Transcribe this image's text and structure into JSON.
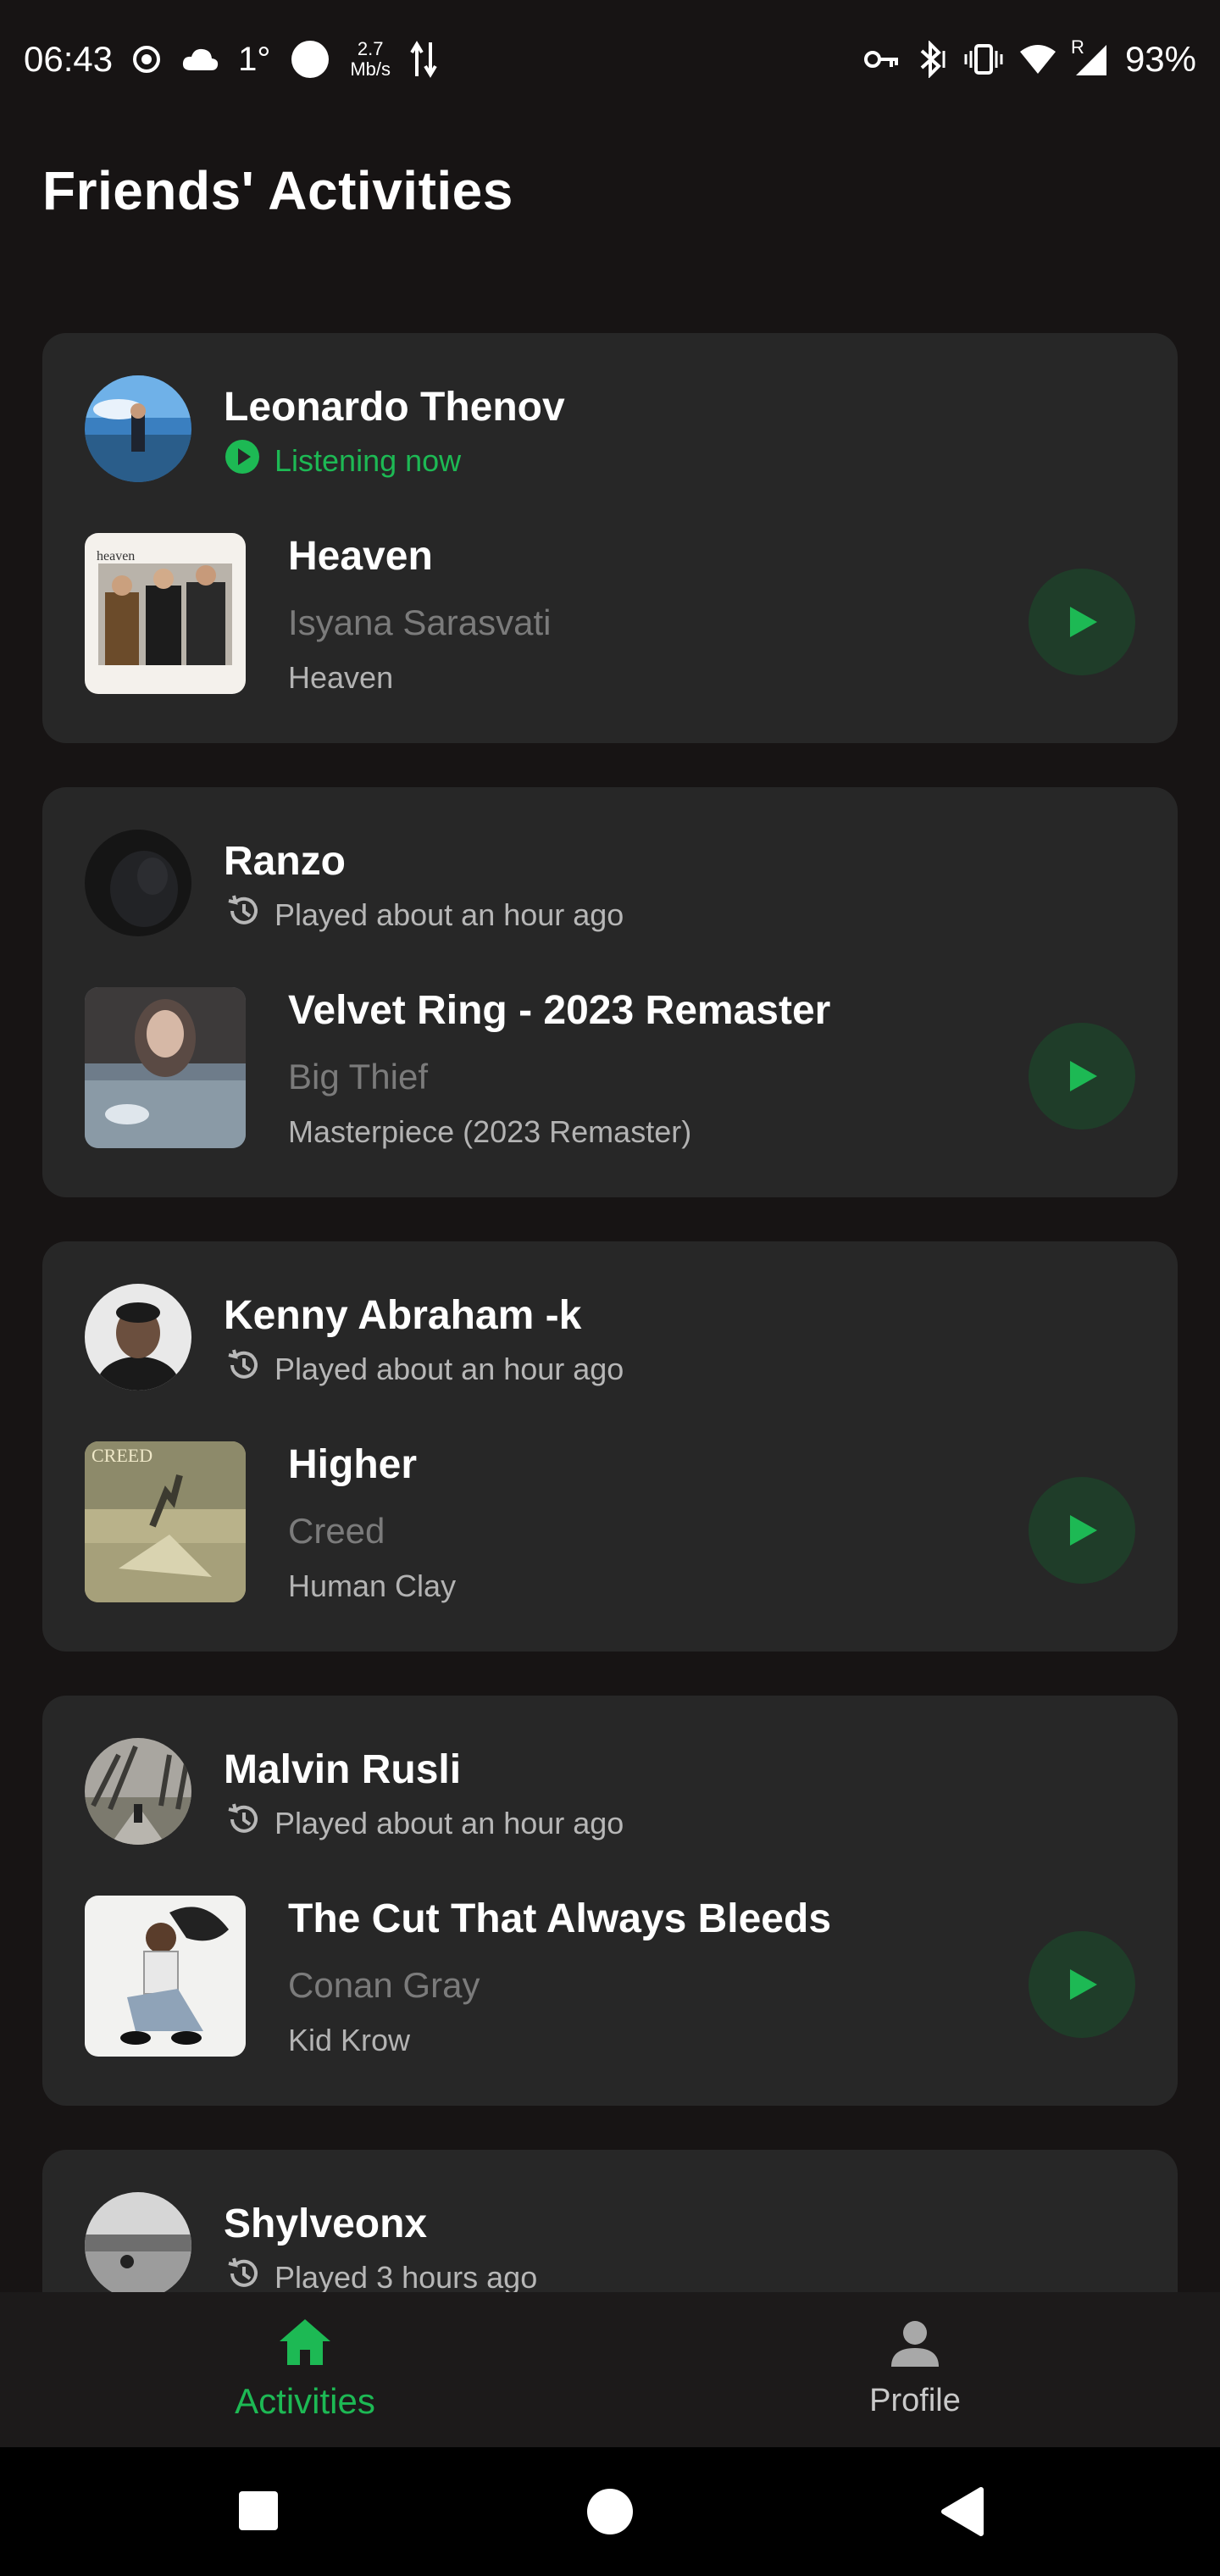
{
  "status_bar": {
    "time": "06:43",
    "temp": "1°",
    "speed_value": "2.7",
    "speed_unit": "Mb/s",
    "battery": "93%",
    "roaming": "R"
  },
  "page": {
    "title": "Friends' Activities"
  },
  "activities": [
    {
      "friend": "Leonardo Thenov",
      "status": "Listening now",
      "live": true,
      "track": "Heaven",
      "artist": "Isyana Sarasvati",
      "album": "Heaven",
      "cover_text": "heaven"
    },
    {
      "friend": "Ranzo",
      "status": "Played about an hour ago",
      "live": false,
      "track": "Velvet Ring - 2023 Remaster",
      "artist": "Big Thief",
      "album": "Masterpiece (2023 Remaster)"
    },
    {
      "friend": "Kenny Abraham -k",
      "status": "Played about an hour ago",
      "live": false,
      "track": "Higher",
      "artist": "Creed",
      "album": "Human Clay",
      "cover_text": "CREED"
    },
    {
      "friend": "Malvin Rusli",
      "status": "Played about an hour ago",
      "live": false,
      "track": "The Cut That Always Bleeds",
      "artist": "Conan Gray",
      "album": "Kid Krow"
    },
    {
      "friend": "Shylveonx",
      "status": "Played 3 hours ago",
      "live": false
    }
  ],
  "bottom_nav": {
    "activities_label": "Activities",
    "profile_label": "Profile"
  },
  "colors": {
    "accent": "#1db954",
    "background": "#171414",
    "card": "#272727"
  }
}
